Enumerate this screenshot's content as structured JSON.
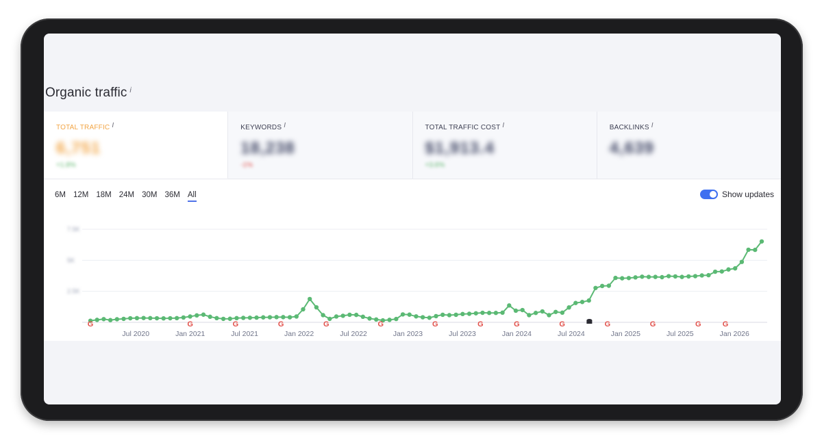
{
  "title": "Organic traffic",
  "info_icon": "i",
  "metrics": [
    {
      "label": "TOTAL TRAFFIC",
      "value": "6,751",
      "change": "+1.8%",
      "change_sign": "pos",
      "active": true
    },
    {
      "label": "KEYWORDS",
      "value": "18,238",
      "change": "-1%",
      "change_sign": "neg",
      "active": false
    },
    {
      "label": "TOTAL TRAFFIC COST",
      "value": "$1,913.4",
      "change": "+3.6%",
      "change_sign": "pos",
      "active": false
    },
    {
      "label": "BACKLINKS",
      "value": "4,639",
      "change": "",
      "change_sign": "",
      "active": false
    }
  ],
  "ranges": [
    "6M",
    "12M",
    "18M",
    "24M",
    "30M",
    "36M",
    "All"
  ],
  "active_range": "All",
  "show_updates": {
    "label": "Show updates",
    "on": true
  },
  "colors": {
    "line": "#5bb974",
    "accent": "#f2a545",
    "toggle": "#3e6ff0"
  },
  "chart_data": {
    "type": "line",
    "x_start": "Feb 2020",
    "x_step": "month",
    "x_tick_labels": [
      "Jul 2020",
      "Jan 2021",
      "Jul 2021",
      "Jan 2022",
      "Jul 2022",
      "Jan 2023",
      "Jul 2023",
      "Jan 2024",
      "Jul 2024",
      "Jan 2025",
      "Jul 2025",
      "Jan 2026"
    ],
    "y_tick_labels": [
      "7.5K",
      "5K",
      "2.5K"
    ],
    "ylim": [
      0,
      7500
    ],
    "grid": true,
    "series": [
      {
        "values": [
          130,
          200,
          260,
          180,
          250,
          280,
          330,
          340,
          350,
          340,
          330,
          320,
          330,
          340,
          390,
          470,
          560,
          620,
          450,
          340,
          280,
          290,
          340,
          360,
          370,
          380,
          400,
          410,
          420,
          420,
          410,
          470,
          1050,
          1880,
          1210,
          580,
          280,
          470,
          530,
          610,
          600,
          450,
          310,
          230,
          160,
          200,
          270,
          640,
          620,
          480,
          410,
          370,
          500,
          610,
          580,
          610,
          670,
          690,
          730,
          770,
          760,
          760,
          780,
          1360,
          940,
          990,
          580,
          760,
          880,
          580,
          840,
          780,
          1200,
          1560,
          1640,
          1760,
          2770,
          2930,
          2950,
          3580,
          3550,
          3570,
          3620,
          3680,
          3660,
          3660,
          3640,
          3720,
          3700,
          3660,
          3700,
          3720,
          3780,
          3800,
          4080,
          4100,
          4260,
          4350,
          4870,
          5850,
          5840,
          6520
        ]
      }
    ],
    "update_markers": [
      "Feb 2020",
      "Jan 2021",
      "Jun 2021",
      "Nov 2021",
      "Apr 2022",
      "Oct 2022",
      "Apr 2023",
      "Sep 2023",
      "Jan 2024",
      "Jun 2024",
      "Nov 2024",
      "Apr 2025",
      "Sep 2025",
      "Dec 2025"
    ],
    "other_markers": [
      "Sep 2024"
    ]
  }
}
